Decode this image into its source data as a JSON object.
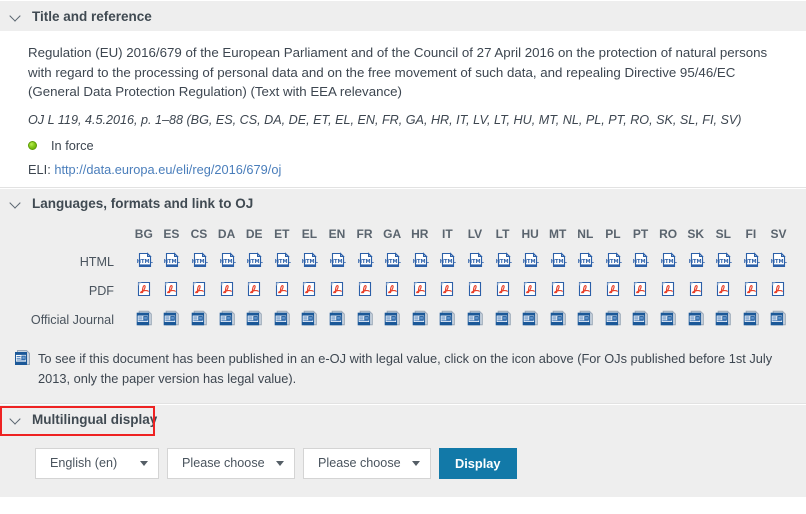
{
  "sections": {
    "title_reference": {
      "header": "Title and reference",
      "title_text": "Regulation (EU) 2016/679 of the European Parliament and of the Council of 27 April 2016 on the protection of natural persons with regard to the processing of personal data and on the free movement of such data, and repealing Directive 95/46/EC (General Data Protection Regulation) (Text with EEA relevance)",
      "oj_reference": "OJ L 119, 4.5.2016, p. 1–88 (BG, ES, CS, DA, DE, ET, EL, EN, FR, GA, HR, IT, LV, LT, HU, MT, NL, PL, PT, RO, SK, SL, FI, SV)",
      "status": "In force",
      "eli_label": "ELI:",
      "eli_url": "http://data.europa.eu/eli/reg/2016/679/oj"
    },
    "languages": {
      "header": "Languages, formats and link to OJ",
      "language_codes": [
        "BG",
        "ES",
        "CS",
        "DA",
        "DE",
        "ET",
        "EL",
        "EN",
        "FR",
        "GA",
        "HR",
        "IT",
        "LV",
        "LT",
        "HU",
        "MT",
        "NL",
        "PL",
        "PT",
        "RO",
        "SK",
        "SL",
        "FI",
        "SV"
      ],
      "rows": [
        {
          "label": "HTML",
          "icon": "html-document-icon"
        },
        {
          "label": "PDF",
          "icon": "pdf-document-icon"
        },
        {
          "label": "Official Journal",
          "icon": "official-journal-icon"
        }
      ],
      "note_icon": "official-journal-icon",
      "note_text": "To see if this document has been published in an e-OJ with legal value, click on the icon above (For OJs published before 1st July 2013, only the paper version has legal value)."
    },
    "multilingual": {
      "header": "Multilingual display",
      "highlighted": true,
      "highlight_color": "#ee2222",
      "selects": [
        {
          "name": "language-1-select",
          "value": "English (en)"
        },
        {
          "name": "language-2-select",
          "value": "Please choose"
        },
        {
          "name": "language-3-select",
          "value": "Please choose"
        }
      ],
      "display_button": "Display"
    }
  },
  "colors": {
    "header_bg": "#eeeeee",
    "accent_button": "#1279a8",
    "link": "#4a7ebb",
    "status_green": "#84c918",
    "highlight_red": "#ee2222"
  }
}
